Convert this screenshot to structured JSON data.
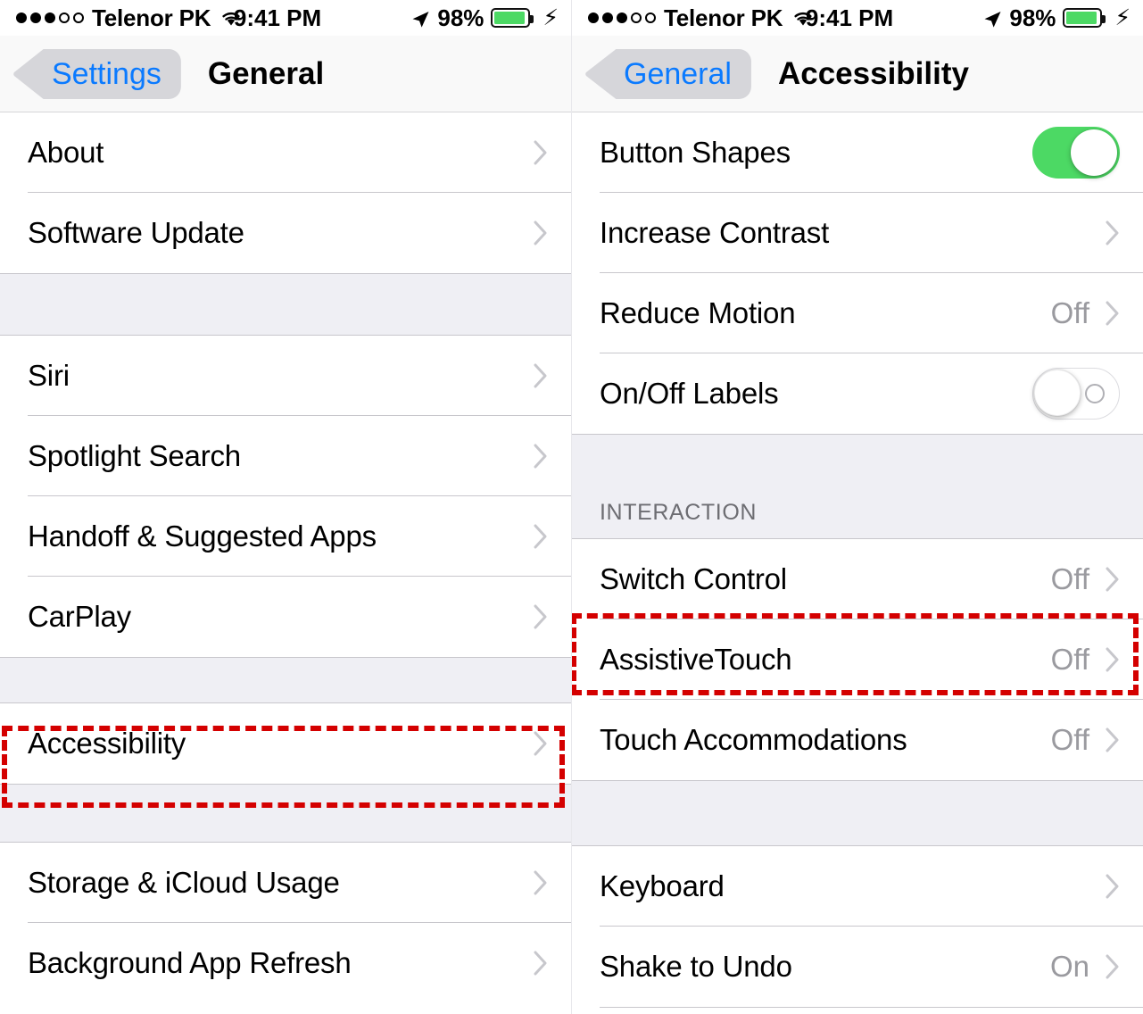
{
  "status_bar": {
    "signal_dots": [
      true,
      true,
      true,
      false,
      false
    ],
    "carrier": "Telenor PK",
    "wifi_icon": "wifi-icon",
    "time": "9:41 PM",
    "location_icon": "location-arrow-icon",
    "battery_percent": "98%",
    "battery_fill": 93,
    "charging_icon": "lightning-bolt-icon",
    "battery_color": "#4cd964"
  },
  "left_panel": {
    "nav": {
      "back_label": "Settings",
      "back_icon": "back-chevron-icon",
      "title": "General"
    },
    "accent_color": "#0a7aff",
    "groups": [
      {
        "rows": [
          {
            "label": "About",
            "value": "",
            "accessory": "chevron"
          },
          {
            "label": "Software Update",
            "value": "",
            "accessory": "chevron"
          }
        ]
      },
      {
        "rows": [
          {
            "label": "Siri",
            "value": "",
            "accessory": "chevron"
          },
          {
            "label": "Spotlight Search",
            "value": "",
            "accessory": "chevron"
          },
          {
            "label": "Handoff & Suggested Apps",
            "value": "",
            "accessory": "chevron"
          },
          {
            "label": "CarPlay",
            "value": "",
            "accessory": "chevron"
          }
        ]
      },
      {
        "rows": [
          {
            "label": "Accessibility",
            "value": "",
            "accessory": "chevron",
            "highlighted": true
          }
        ]
      },
      {
        "rows": [
          {
            "label": "Storage & iCloud Usage",
            "value": "",
            "accessory": "chevron"
          },
          {
            "label": "Background App Refresh",
            "value": "",
            "accessory": "chevron"
          }
        ]
      }
    ],
    "annotation": {
      "target": "Accessibility",
      "color": "#d40000"
    }
  },
  "right_panel": {
    "nav": {
      "back_label": "General",
      "back_icon": "back-chevron-icon",
      "title": "Accessibility"
    },
    "accent_color": "#0a7aff",
    "groups": [
      {
        "header": "",
        "rows": [
          {
            "label": "Button Shapes",
            "value": "",
            "accessory": "toggle",
            "toggle_on": true
          },
          {
            "label": "Increase Contrast",
            "value": "",
            "accessory": "chevron"
          },
          {
            "label": "Reduce Motion",
            "value": "Off",
            "accessory": "chevron"
          },
          {
            "label": "On/Off Labels",
            "value": "",
            "accessory": "toggle",
            "toggle_on": false
          }
        ]
      },
      {
        "header": "INTERACTION",
        "rows": [
          {
            "label": "Switch Control",
            "value": "Off",
            "accessory": "chevron"
          },
          {
            "label": "AssistiveTouch",
            "value": "Off",
            "accessory": "chevron",
            "highlighted": true
          },
          {
            "label": "Touch Accommodations",
            "value": "Off",
            "accessory": "chevron"
          }
        ]
      },
      {
        "header": "",
        "rows": [
          {
            "label": "Keyboard",
            "value": "",
            "accessory": "chevron"
          },
          {
            "label": "Shake to Undo",
            "value": "On",
            "accessory": "chevron"
          }
        ]
      }
    ],
    "annotation": {
      "target": "AssistiveTouch",
      "color": "#d40000"
    }
  }
}
